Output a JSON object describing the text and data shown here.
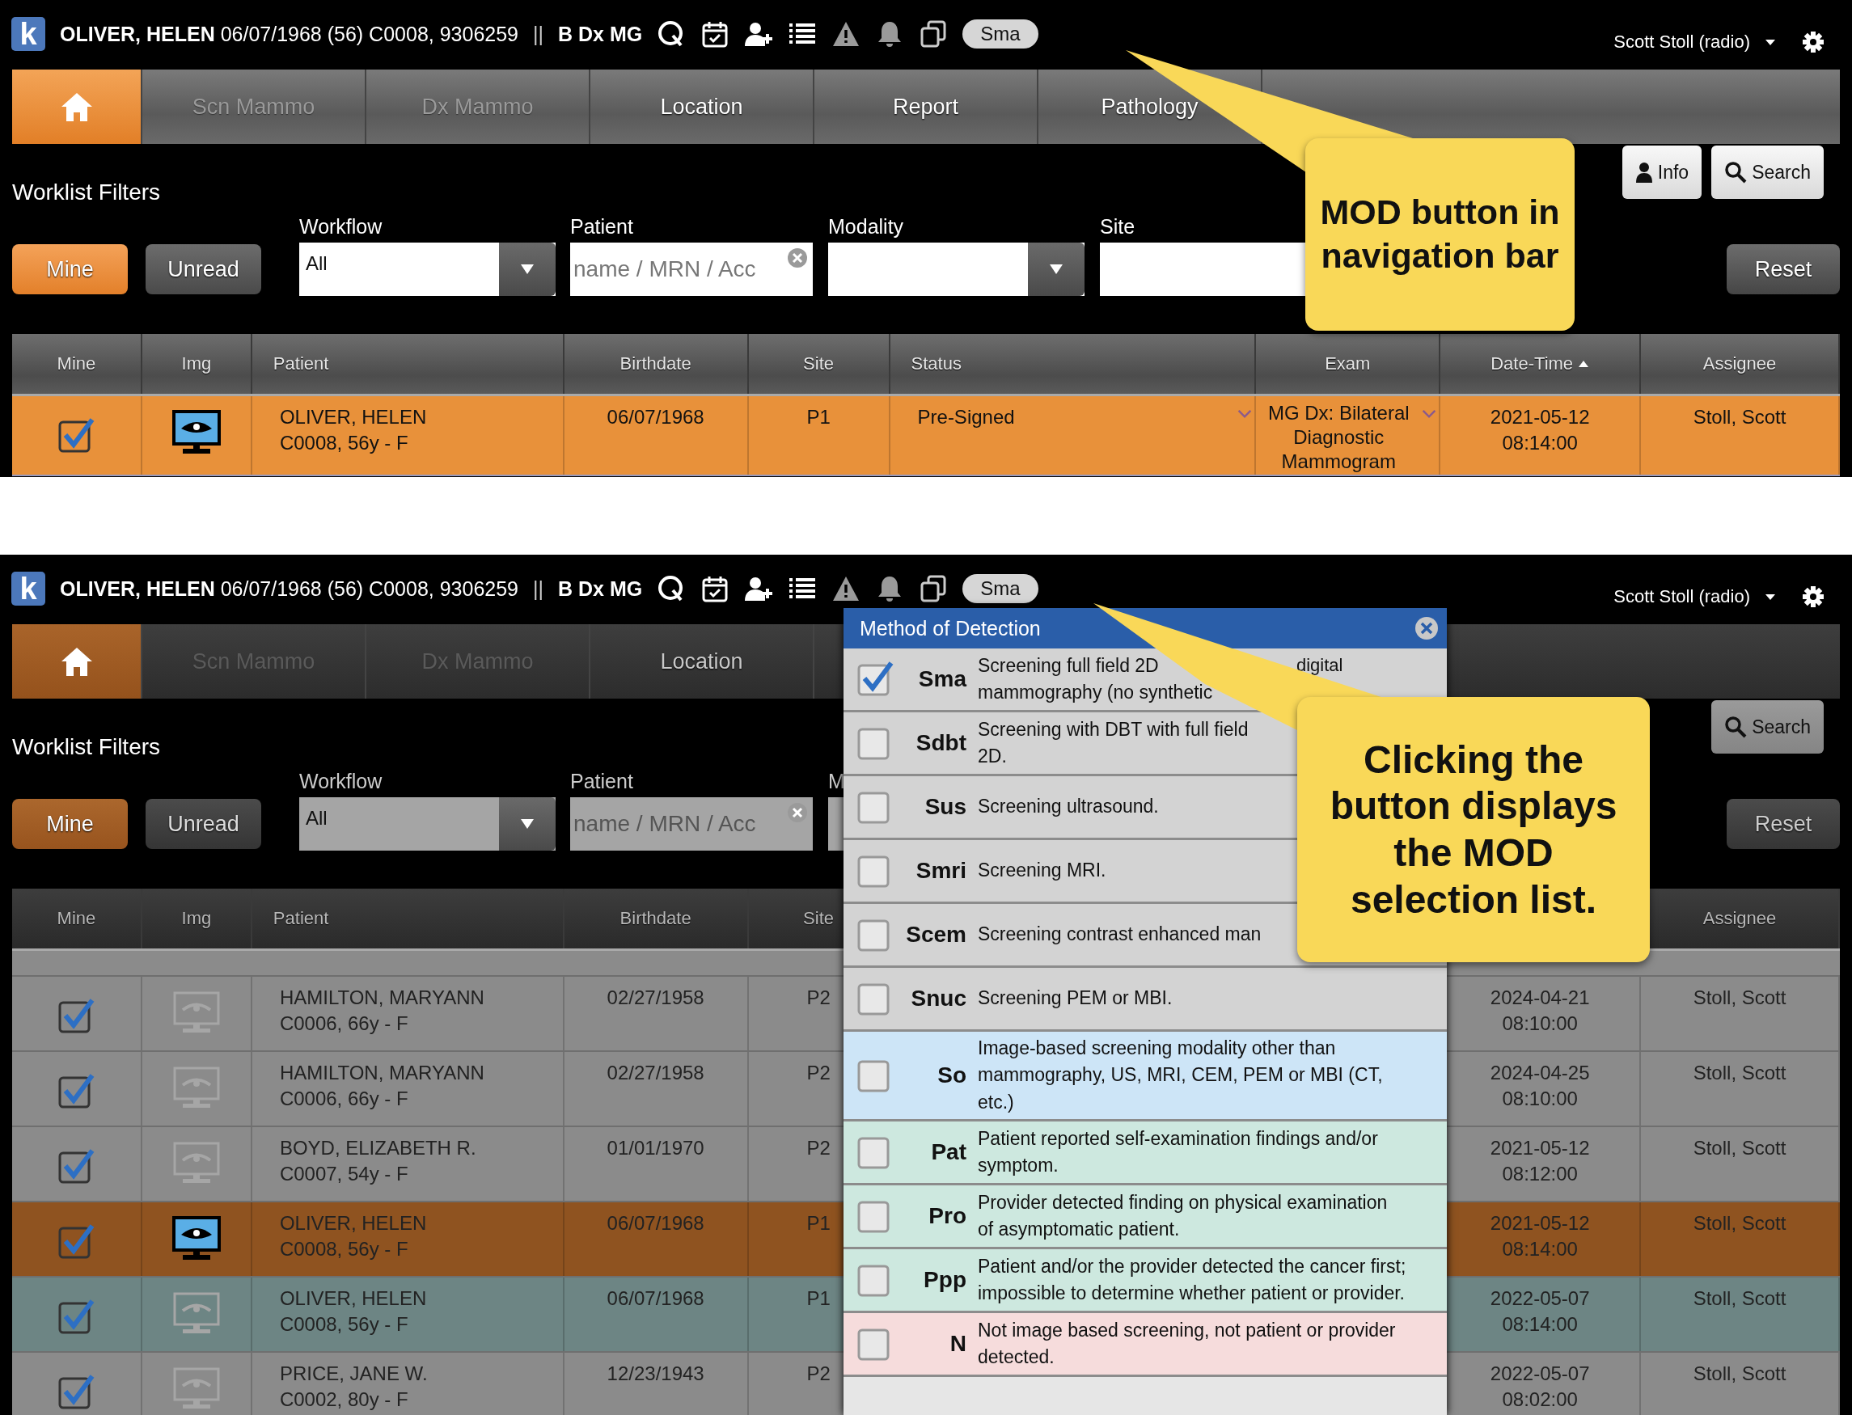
{
  "screens": [
    {
      "top_bar": {
        "logo": "k",
        "patient_name": "OLIVER, HELEN",
        "patient_details": "06/07/1968 (56) C0008, 9306259",
        "separator": "||",
        "exam": "B Dx MG",
        "mod_button": "Sma",
        "user": "Scott Stoll (radio)"
      },
      "tabs": [
        {
          "kind": "home",
          "selected": true,
          "disabled": false
        },
        {
          "kind": "text",
          "label": "Scn Mammo",
          "selected": false,
          "disabled": true
        },
        {
          "kind": "text",
          "label": "Dx Mammo",
          "selected": false,
          "disabled": true
        },
        {
          "kind": "text",
          "label": "Location",
          "selected": false,
          "disabled": false
        },
        {
          "kind": "text",
          "label": "Report",
          "selected": false,
          "disabled": false
        },
        {
          "kind": "text",
          "label": "Pathology",
          "selected": false,
          "disabled": false
        }
      ],
      "filters": {
        "title": "Worklist Filters",
        "info_button": "Info",
        "search_button": "Search",
        "reset_button": "Reset",
        "buttons": [
          {
            "label": "Mine",
            "selected": true
          },
          {
            "label": "Unread",
            "selected": false
          }
        ],
        "workflow": {
          "label": "Workflow",
          "value": "All"
        },
        "patient": {
          "label": "Patient",
          "placeholder": "name / MRN / Acc"
        },
        "modality": {
          "label": "Modality"
        },
        "site": {
          "label": "Site"
        }
      },
      "table": {
        "columns": {
          "mine": "Mine",
          "img": "Img",
          "patient": "Patient",
          "birthdate": "Birthdate",
          "site": "Site",
          "status": "Status",
          "exam": "Exam",
          "date_time": "Date-Time",
          "assignee": "Assignee"
        },
        "date_time_sort_ascending": true,
        "rows": [
          {
            "color": "#e8913a",
            "mine": true,
            "img_active": true,
            "patient_name": "OLIVER, HELEN",
            "patient_info": "C0008, 56y - F",
            "birthdate": "06/07/1968",
            "site": "P1",
            "status": "Pre-Signed",
            "exam": "MG Dx: Bilateral Diagnostic Mammogram",
            "date": "2021-05-12",
            "time": "08:14:00",
            "assignee": "Stoll, Scott"
          }
        ]
      },
      "callout": {
        "text": "MOD button in navigation bar"
      }
    },
    {
      "top_bar": {
        "logo": "k",
        "patient_name": "OLIVER, HELEN",
        "patient_details": "06/07/1968 (56) C0008, 9306259",
        "separator": "||",
        "exam": "B Dx MG",
        "mod_button": "Sma",
        "user": "Scott Stoll (radio)"
      },
      "tabs": [
        {
          "kind": "home",
          "selected": true,
          "disabled": false
        },
        {
          "kind": "text",
          "label": "Scn Mammo",
          "selected": false,
          "disabled": true
        },
        {
          "kind": "text",
          "label": "Dx Mammo",
          "selected": false,
          "disabled": true
        },
        {
          "kind": "text",
          "label": "Location",
          "selected": false,
          "disabled": false
        }
      ],
      "filters": {
        "title": "Worklist Filters",
        "search_button": "Search",
        "reset_button": "Reset",
        "buttons": [
          {
            "label": "Mine",
            "selected": true
          },
          {
            "label": "Unread",
            "selected": false
          }
        ],
        "workflow": {
          "label": "Workflow",
          "value": "All"
        },
        "patient": {
          "label": "Patient",
          "placeholder": "name / MRN / Acc"
        },
        "modality": {
          "label": "M"
        }
      },
      "table": {
        "columns": {
          "mine": "Mine",
          "img": "Img",
          "patient": "Patient",
          "birthdate": "Birthdate",
          "site": "Site",
          "assignee": "Assignee"
        },
        "rows": [
          {
            "color": "#8b8b8b",
            "mine": true,
            "img_active": false,
            "patient_name": "HAMILTON, MARYANN",
            "patient_info": "C0006, 66y - F",
            "birthdate": "02/27/1958",
            "site": "P2",
            "date": "2024-04-21",
            "time": "08:10:00",
            "assignee": "Stoll, Scott"
          },
          {
            "color": "#8b8b8b",
            "mine": true,
            "img_active": false,
            "patient_name": "HAMILTON, MARYANN",
            "patient_info": "C0006, 66y - F",
            "birthdate": "02/27/1958",
            "site": "P2",
            "date": "2024-04-25",
            "time": "08:10:00",
            "assignee": "Stoll, Scott"
          },
          {
            "color": "#8b8b8b",
            "mine": true,
            "img_active": false,
            "patient_name": "BOYD, ELIZABETH R.",
            "patient_info": "C0007, 54y - F",
            "birthdate": "01/01/1970",
            "site": "P2",
            "date": "2021-05-12",
            "time": "08:12:00",
            "assignee": "Stoll, Scott"
          },
          {
            "color": "#8f5320",
            "mine": true,
            "img_active": true,
            "patient_name": "OLIVER, HELEN",
            "patient_info": "C0008, 56y - F",
            "birthdate": "06/07/1968",
            "site": "P1",
            "date": "2021-05-12",
            "time": "08:14:00",
            "assignee": "Stoll, Scott"
          },
          {
            "color": "#6d8584",
            "mine": true,
            "img_active": false,
            "patient_name": "OLIVER, HELEN",
            "patient_info": "C0008, 56y - F",
            "birthdate": "06/07/1968",
            "site": "P1",
            "date": "2022-05-07",
            "time": "08:14:00",
            "assignee": "Stoll, Scott"
          },
          {
            "color": "#8b8b8b",
            "mine": true,
            "img_active": false,
            "patient_name": "PRICE, JANE W.",
            "patient_info": "C0002, 80y - F",
            "birthdate": "12/23/1943",
            "site": "P2",
            "date": "2022-05-07",
            "time": "08:02:00",
            "assignee": "Stoll, Scott"
          }
        ]
      },
      "mod_popup": {
        "title": "Method of Detection",
        "items": [
          {
            "code": "Sma",
            "description": "Screening full field 2D\nmammography (no synthetic",
            "description_right": "digital",
            "checked": true,
            "color": "#d3d3d3"
          },
          {
            "code": "Sdbt",
            "description": "Screening with DBT with full field\n2D.",
            "checked": false,
            "color": "#d3d3d3"
          },
          {
            "code": "Sus",
            "description": "Screening ultrasound.",
            "checked": false,
            "color": "#d3d3d3"
          },
          {
            "code": "Smri",
            "description": "Screening MRI.",
            "checked": false,
            "color": "#d3d3d3"
          },
          {
            "code": "Scem",
            "description": "Screening contrast enhanced man",
            "checked": false,
            "color": "#d3d3d3"
          },
          {
            "code": "Snuc",
            "description": "Screening PEM or MBI.",
            "checked": false,
            "color": "#d3d3d3"
          },
          {
            "code": "So",
            "description": "Image-based screening modality other than mammography, US, MRI, CEM, PEM or MBI (CT, etc.)",
            "checked": false,
            "color": "#cde5f7"
          },
          {
            "code": "Pat",
            "description": "Patient reported self-examination findings and/or symptom.",
            "checked": false,
            "color": "#cde8df"
          },
          {
            "code": "Pro",
            "description": "Provider detected finding on physical examination of asymptomatic patient.",
            "checked": false,
            "color": "#cde8df"
          },
          {
            "code": "Ppp",
            "description": "Patient and/or the provider detected the cancer first; impossible to determine whether patient or provider.",
            "checked": false,
            "color": "#cde8df"
          },
          {
            "code": "N",
            "description": "Not image based screening, not patient or provider detected.",
            "checked": false,
            "color": "#f6dcdc"
          }
        ]
      },
      "callout": {
        "text": "Clicking the button displays the MOD selection list."
      }
    }
  ]
}
